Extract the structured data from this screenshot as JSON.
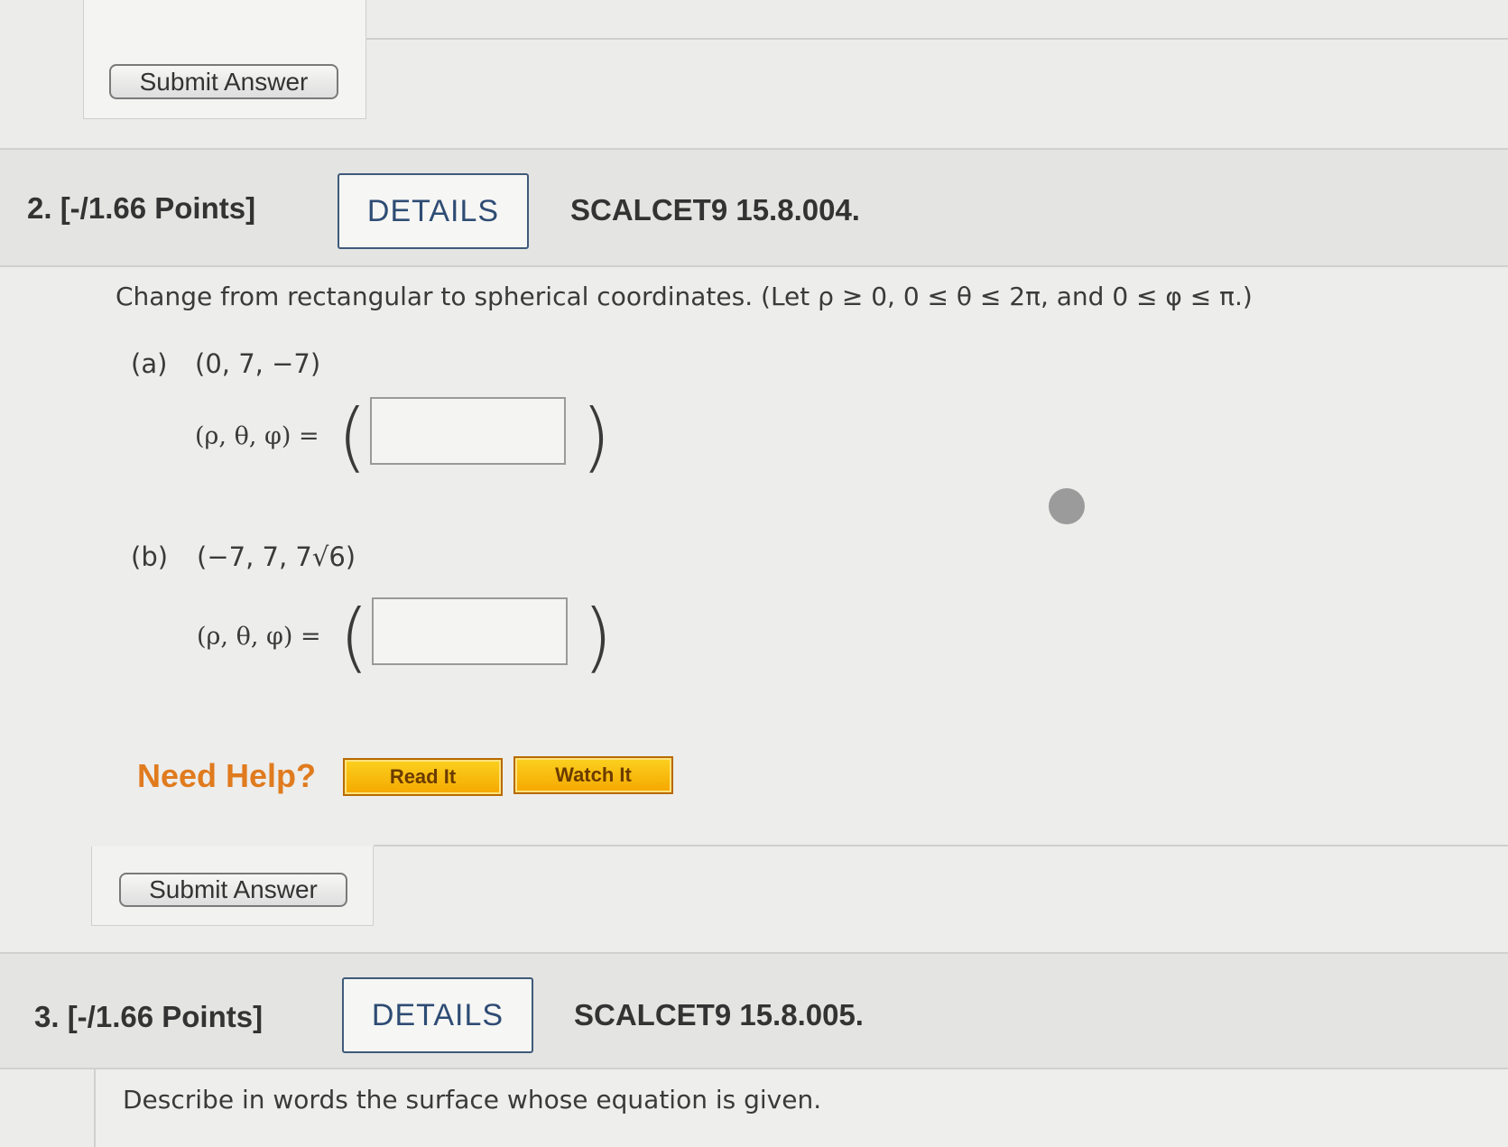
{
  "top_section": {
    "submit_label": "Submit Answer"
  },
  "question2": {
    "number_points": "2.  [-/1.66 Points]",
    "details_label": "DETAILS",
    "reference": "SCALCET9 15.8.004.",
    "prompt": "Change from rectangular to spherical coordinates. (Let ρ ≥ 0, 0 ≤ θ ≤ 2π, and 0 ≤ φ ≤ π.)",
    "parts": [
      {
        "label": "(a)",
        "point": "(0, 7, −7)",
        "lhs": "(ρ, θ, φ) =",
        "answer_value": ""
      },
      {
        "label": "(b)",
        "point": "(−7, 7, 7√6)",
        "lhs": "(ρ, θ, φ) =",
        "answer_value": ""
      }
    ],
    "need_help": "Need Help?",
    "read_it_label": "Read It",
    "watch_it_label": "Watch It",
    "submit_label": "Submit Answer"
  },
  "question3": {
    "number_points": "3.  [-/1.66 Points]",
    "details_label": "DETAILS",
    "reference": "SCALCET9 15.8.005.",
    "prompt": "Describe in words the surface whose equation is given."
  },
  "colors": {
    "need_help": "#e07b1e",
    "help_button": "#f5a700",
    "details_text": "#2e4c74"
  }
}
